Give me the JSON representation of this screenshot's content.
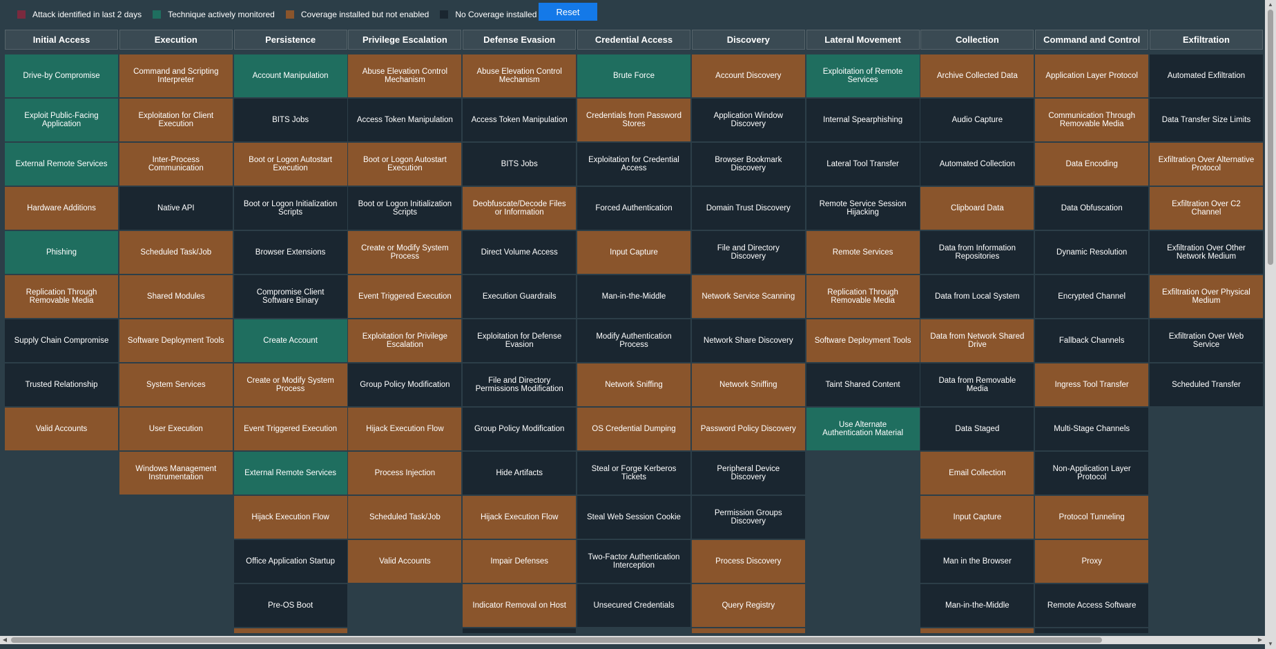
{
  "legend": [
    {
      "label": "Attack identified in last 2 days",
      "color": "#7a2a3e"
    },
    {
      "label": "Technique actively monitored",
      "color": "#1f6e5f"
    },
    {
      "label": "Coverage installed but not enabled",
      "color": "#8a552c"
    },
    {
      "label": "No Coverage installed",
      "color": "#1a2630"
    }
  ],
  "reset_label": "Reset",
  "columns": [
    {
      "title": "Initial Access",
      "cells": [
        {
          "label": "Drive-by Compromise",
          "status": "green"
        },
        {
          "label": "Exploit Public-Facing Application",
          "status": "green"
        },
        {
          "label": "External Remote Services",
          "status": "green"
        },
        {
          "label": "Hardware Additions",
          "status": "orange"
        },
        {
          "label": "Phishing",
          "status": "green"
        },
        {
          "label": "Replication Through Removable Media",
          "status": "orange"
        },
        {
          "label": "Supply Chain Compromise",
          "status": "dark"
        },
        {
          "label": "Trusted Relationship",
          "status": "dark"
        },
        {
          "label": "Valid Accounts",
          "status": "orange"
        }
      ]
    },
    {
      "title": "Execution",
      "cells": [
        {
          "label": "Command and Scripting Interpreter",
          "status": "orange"
        },
        {
          "label": "Exploitation for Client Execution",
          "status": "orange"
        },
        {
          "label": "Inter-Process Communication",
          "status": "orange"
        },
        {
          "label": "Native API",
          "status": "dark"
        },
        {
          "label": "Scheduled Task/Job",
          "status": "orange"
        },
        {
          "label": "Shared Modules",
          "status": "orange"
        },
        {
          "label": "Software Deployment Tools",
          "status": "orange"
        },
        {
          "label": "System Services",
          "status": "orange"
        },
        {
          "label": "User Execution",
          "status": "orange"
        },
        {
          "label": "Windows Management Instrumentation",
          "status": "orange"
        }
      ]
    },
    {
      "title": "Persistence",
      "cells": [
        {
          "label": "Account Manipulation",
          "status": "green"
        },
        {
          "label": "BITS Jobs",
          "status": "dark"
        },
        {
          "label": "Boot or Logon Autostart Execution",
          "status": "orange"
        },
        {
          "label": "Boot or Logon Initialization Scripts",
          "status": "dark"
        },
        {
          "label": "Browser Extensions",
          "status": "dark"
        },
        {
          "label": "Compromise Client Software Binary",
          "status": "dark"
        },
        {
          "label": "Create Account",
          "status": "green"
        },
        {
          "label": "Create or Modify System Process",
          "status": "orange"
        },
        {
          "label": "Event Triggered Execution",
          "status": "orange"
        },
        {
          "label": "External Remote Services",
          "status": "green"
        },
        {
          "label": "Hijack Execution Flow",
          "status": "orange"
        },
        {
          "label": "Office Application Startup",
          "status": "dark"
        },
        {
          "label": "Pre-OS Boot",
          "status": "dark"
        },
        {
          "label": "",
          "status": "orange"
        }
      ]
    },
    {
      "title": "Privilege Escalation",
      "cells": [
        {
          "label": "Abuse Elevation Control Mechanism",
          "status": "orange"
        },
        {
          "label": "Access Token Manipulation",
          "status": "dark"
        },
        {
          "label": "Boot or Logon Autostart Execution",
          "status": "orange"
        },
        {
          "label": "Boot or Logon Initialization Scripts",
          "status": "dark"
        },
        {
          "label": "Create or Modify System Process",
          "status": "orange"
        },
        {
          "label": "Event Triggered Execution",
          "status": "orange"
        },
        {
          "label": "Exploitation for Privilege Escalation",
          "status": "orange"
        },
        {
          "label": "Group Policy Modification",
          "status": "dark"
        },
        {
          "label": "Hijack Execution Flow",
          "status": "orange"
        },
        {
          "label": "Process Injection",
          "status": "orange"
        },
        {
          "label": "Scheduled Task/Job",
          "status": "orange"
        },
        {
          "label": "Valid Accounts",
          "status": "orange"
        }
      ]
    },
    {
      "title": "Defense Evasion",
      "cells": [
        {
          "label": "Abuse Elevation Control Mechanism",
          "status": "orange"
        },
        {
          "label": "Access Token Manipulation",
          "status": "dark"
        },
        {
          "label": "BITS Jobs",
          "status": "dark"
        },
        {
          "label": "Deobfuscate/Decode Files or Information",
          "status": "orange"
        },
        {
          "label": "Direct Volume Access",
          "status": "dark"
        },
        {
          "label": "Execution Guardrails",
          "status": "dark"
        },
        {
          "label": "Exploitation for Defense Evasion",
          "status": "dark"
        },
        {
          "label": "File and Directory Permissions Modification",
          "status": "dark"
        },
        {
          "label": "Group Policy Modification",
          "status": "dark"
        },
        {
          "label": "Hide Artifacts",
          "status": "dark"
        },
        {
          "label": "Hijack Execution Flow",
          "status": "orange"
        },
        {
          "label": "Impair Defenses",
          "status": "orange"
        },
        {
          "label": "Indicator Removal on Host",
          "status": "orange"
        },
        {
          "label": "",
          "status": "dark"
        }
      ]
    },
    {
      "title": "Credential Access",
      "cells": [
        {
          "label": "Brute Force",
          "status": "green"
        },
        {
          "label": "Credentials from Password Stores",
          "status": "orange"
        },
        {
          "label": "Exploitation for Credential Access",
          "status": "dark"
        },
        {
          "label": "Forced Authentication",
          "status": "dark"
        },
        {
          "label": "Input Capture",
          "status": "orange"
        },
        {
          "label": "Man-in-the-Middle",
          "status": "dark"
        },
        {
          "label": "Modify Authentication Process",
          "status": "dark"
        },
        {
          "label": "Network Sniffing",
          "status": "orange"
        },
        {
          "label": "OS Credential Dumping",
          "status": "orange"
        },
        {
          "label": "Steal or Forge Kerberos Tickets",
          "status": "dark"
        },
        {
          "label": "Steal Web Session Cookie",
          "status": "dark"
        },
        {
          "label": "Two-Factor Authentication Interception",
          "status": "dark"
        },
        {
          "label": "Unsecured Credentials",
          "status": "dark"
        }
      ]
    },
    {
      "title": "Discovery",
      "cells": [
        {
          "label": "Account Discovery",
          "status": "orange"
        },
        {
          "label": "Application Window Discovery",
          "status": "dark"
        },
        {
          "label": "Browser Bookmark Discovery",
          "status": "dark"
        },
        {
          "label": "Domain Trust Discovery",
          "status": "dark"
        },
        {
          "label": "File and Directory Discovery",
          "status": "dark"
        },
        {
          "label": "Network Service Scanning",
          "status": "orange"
        },
        {
          "label": "Network Share Discovery",
          "status": "dark"
        },
        {
          "label": "Network Sniffing",
          "status": "orange"
        },
        {
          "label": "Password Policy Discovery",
          "status": "orange"
        },
        {
          "label": "Peripheral Device Discovery",
          "status": "dark"
        },
        {
          "label": "Permission Groups Discovery",
          "status": "dark"
        },
        {
          "label": "Process Discovery",
          "status": "orange"
        },
        {
          "label": "Query Registry",
          "status": "orange"
        },
        {
          "label": "",
          "status": "orange"
        }
      ]
    },
    {
      "title": "Lateral Movement",
      "cells": [
        {
          "label": "Exploitation of Remote Services",
          "status": "green"
        },
        {
          "label": "Internal Spearphishing",
          "status": "dark"
        },
        {
          "label": "Lateral Tool Transfer",
          "status": "dark"
        },
        {
          "label": "Remote Service Session Hijacking",
          "status": "dark"
        },
        {
          "label": "Remote Services",
          "status": "orange"
        },
        {
          "label": "Replication Through Removable Media",
          "status": "orange"
        },
        {
          "label": "Software Deployment Tools",
          "status": "orange"
        },
        {
          "label": "Taint Shared Content",
          "status": "dark"
        },
        {
          "label": "Use Alternate Authentication Material",
          "status": "green"
        }
      ]
    },
    {
      "title": "Collection",
      "cells": [
        {
          "label": "Archive Collected Data",
          "status": "orange"
        },
        {
          "label": "Audio Capture",
          "status": "dark"
        },
        {
          "label": "Automated Collection",
          "status": "dark"
        },
        {
          "label": "Clipboard Data",
          "status": "orange"
        },
        {
          "label": "Data from Information Repositories",
          "status": "dark"
        },
        {
          "label": "Data from Local System",
          "status": "dark"
        },
        {
          "label": "Data from Network Shared Drive",
          "status": "orange"
        },
        {
          "label": "Data from Removable Media",
          "status": "dark"
        },
        {
          "label": "Data Staged",
          "status": "dark"
        },
        {
          "label": "Email Collection",
          "status": "orange"
        },
        {
          "label": "Input Capture",
          "status": "orange"
        },
        {
          "label": "Man in the Browser",
          "status": "dark"
        },
        {
          "label": "Man-in-the-Middle",
          "status": "dark"
        },
        {
          "label": "",
          "status": "orange"
        }
      ]
    },
    {
      "title": "Command and Control",
      "cells": [
        {
          "label": "Application Layer Protocol",
          "status": "orange"
        },
        {
          "label": "Communication Through Removable Media",
          "status": "orange"
        },
        {
          "label": "Data Encoding",
          "status": "orange"
        },
        {
          "label": "Data Obfuscation",
          "status": "dark"
        },
        {
          "label": "Dynamic Resolution",
          "status": "dark"
        },
        {
          "label": "Encrypted Channel",
          "status": "dark"
        },
        {
          "label": "Fallback Channels",
          "status": "dark"
        },
        {
          "label": "Ingress Tool Transfer",
          "status": "orange"
        },
        {
          "label": "Multi-Stage Channels",
          "status": "dark"
        },
        {
          "label": "Non-Application Layer Protocol",
          "status": "dark"
        },
        {
          "label": "Protocol Tunneling",
          "status": "orange"
        },
        {
          "label": "Proxy",
          "status": "orange"
        },
        {
          "label": "Remote Access Software",
          "status": "dark"
        },
        {
          "label": "",
          "status": "dark"
        }
      ]
    },
    {
      "title": "Exfiltration",
      "cells": [
        {
          "label": "Automated Exfiltration",
          "status": "dark"
        },
        {
          "label": "Data Transfer Size Limits",
          "status": "dark"
        },
        {
          "label": "Exfiltration Over Alternative Protocol",
          "status": "orange"
        },
        {
          "label": "Exfiltration Over C2 Channel",
          "status": "orange"
        },
        {
          "label": "Exfiltration Over Other Network Medium",
          "status": "dark"
        },
        {
          "label": "Exfiltration Over Physical Medium",
          "status": "orange"
        },
        {
          "label": "Exfiltration Over Web Service",
          "status": "dark"
        },
        {
          "label": "Scheduled Transfer",
          "status": "dark"
        }
      ]
    }
  ]
}
